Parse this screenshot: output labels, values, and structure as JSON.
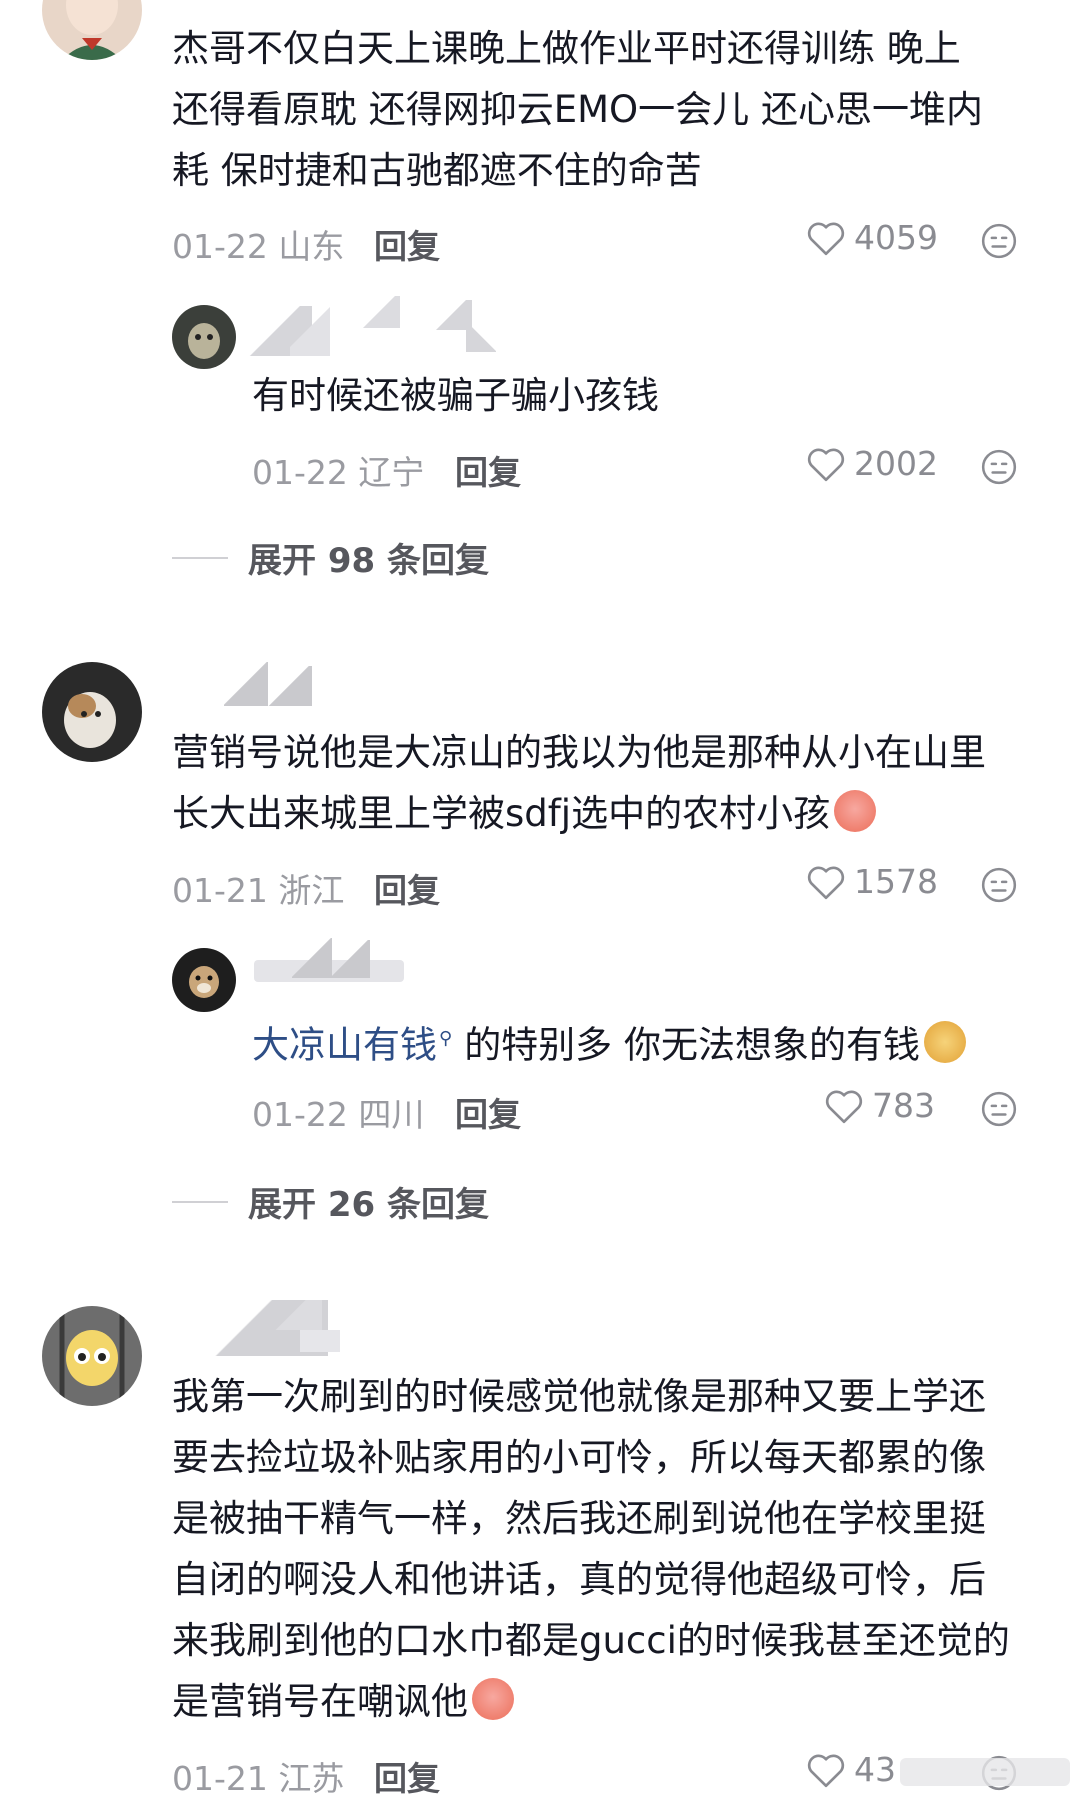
{
  "comments": [
    {
      "text_lines": [
        "杰哥不仅白天上课晚上做作业平时还得训练  晚上",
        "还得看原耽 还得网抑云EMO一会儿 还心思一堆内",
        "耗 保时捷和古驰都遮不住的命苦"
      ],
      "date_location": "01-22 山东",
      "reply_label": "回复",
      "likes": "4059",
      "reply": {
        "text": "有时候还被骗子骗小孩钱",
        "date_location": "01-22 辽宁",
        "reply_label": "回复",
        "likes": "2002"
      },
      "expand_label": "展开 98 条回复"
    },
    {
      "text_lines": [
        "营销号说他是大凉山的我以为他是那种从小在山里",
        "长大出来城里上学被sdfj选中的农村小孩"
      ],
      "date_location": "01-21 浙江",
      "reply_label": "回复",
      "likes": "1578",
      "reply": {
        "link_text": "大凉山有钱",
        "text": "的特别多 你无法想象的有钱",
        "date_location": "01-22 四川",
        "reply_label": "回复",
        "likes": "783"
      },
      "expand_label": "展开 26 条回复"
    },
    {
      "text_lines": [
        "我第一次刷到的时候感觉他就像是那种又要上学还",
        "要去捡垃圾补贴家用的小可怜，所以每天都累的像",
        "是被抽干精气一样，然后我还刷到说他在学校里挺",
        "自闭的啊没人和他讲话，真的觉得他超级可怜，后",
        "来我刷到他的口水巾都是gucci的时候我甚至还觉的",
        "是营销号在嘲讽他"
      ],
      "date_location": "01-21 江苏",
      "reply_label": "回复",
      "likes": "43"
    }
  ],
  "icons": {
    "like": "heart-outline-icon",
    "dislike": "dislike-face-icon",
    "search_hint": "search-icon",
    "emoji_cry": "crying-emoji-icon",
    "emoji_dog": "dog-face-emoji-icon"
  },
  "colors": {
    "text": "#161823",
    "meta": "#9a9ba1",
    "link": "#2e4e86",
    "background": "#ffffff"
  }
}
